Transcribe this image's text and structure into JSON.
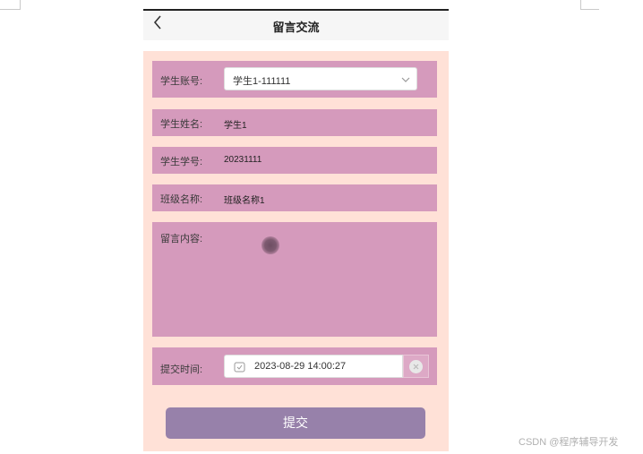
{
  "nav": {
    "title": "留言交流"
  },
  "form": {
    "account_label": "学生账号:",
    "account_value": "学生1-111111",
    "name_label": "学生姓名:",
    "name_value": "学生1",
    "number_label": "学生学号:",
    "number_value": "20231111",
    "class_label": "班级名称:",
    "class_value": "班级名称1",
    "message_label": "留言内容:",
    "time_label": "提交时间:",
    "time_value": "2023-08-29 14:00:27"
  },
  "submit_label": "提交",
  "watermark": "CSDN @程序辅导开发",
  "colors": {
    "page_bg": "#ffe1d7",
    "row_bg": "#d59abc",
    "button_bg": "#9781aa"
  }
}
